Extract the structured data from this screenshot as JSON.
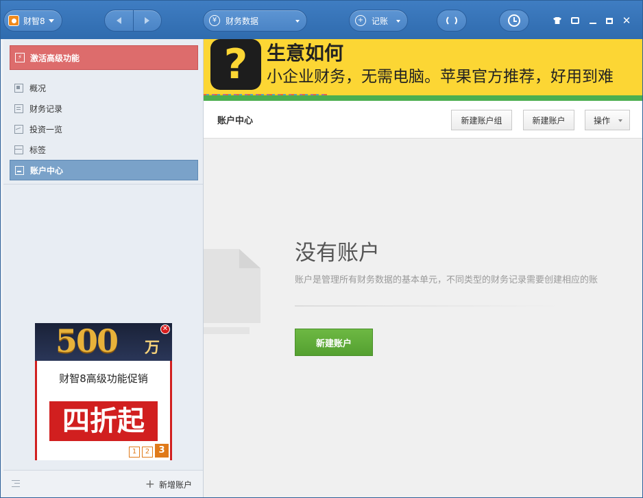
{
  "app": {
    "name": "财智8"
  },
  "titlebar": {
    "data_menu_label": "财务数据",
    "record_menu_label": "记账"
  },
  "sidebar": {
    "activate_label": "激活高级功能",
    "items": [
      {
        "label": "概况",
        "icon": "overview-icon",
        "active": false
      },
      {
        "label": "财务记录",
        "icon": "records-icon",
        "active": false
      },
      {
        "label": "投资一览",
        "icon": "investment-icon",
        "active": false
      },
      {
        "label": "标签",
        "icon": "tags-icon",
        "active": false
      },
      {
        "label": "账户中心",
        "icon": "accounts-icon",
        "active": true
      }
    ],
    "ad": {
      "headline_number": "500",
      "headline_unit": "万",
      "title": "财智8高级功能促销",
      "highlight": "四折起",
      "pages": [
        "1",
        "2",
        "3"
      ],
      "active_page": "3"
    },
    "footer": {
      "add_account_label": "新增账户"
    }
  },
  "banner": {
    "title": "生意如何",
    "subtitle": "小企业财务，无需电脑。苹果官方推荐，好用到难"
  },
  "main": {
    "page_title": "账户中心",
    "buttons": {
      "new_group": "新建账户组",
      "new_account": "新建账户",
      "operations": "操作"
    },
    "empty": {
      "title": "没有账户",
      "description": "账户是管理所有财务数据的基本单元，不同类型的财务记录需要创建相应的账",
      "create_button": "新建账户"
    }
  },
  "colors": {
    "titlebar": "#3a76bb",
    "activate": "#dd6c6c",
    "active_nav": "#7aa2c9",
    "create_button": "#5ea937",
    "banner": "#fcd634"
  }
}
